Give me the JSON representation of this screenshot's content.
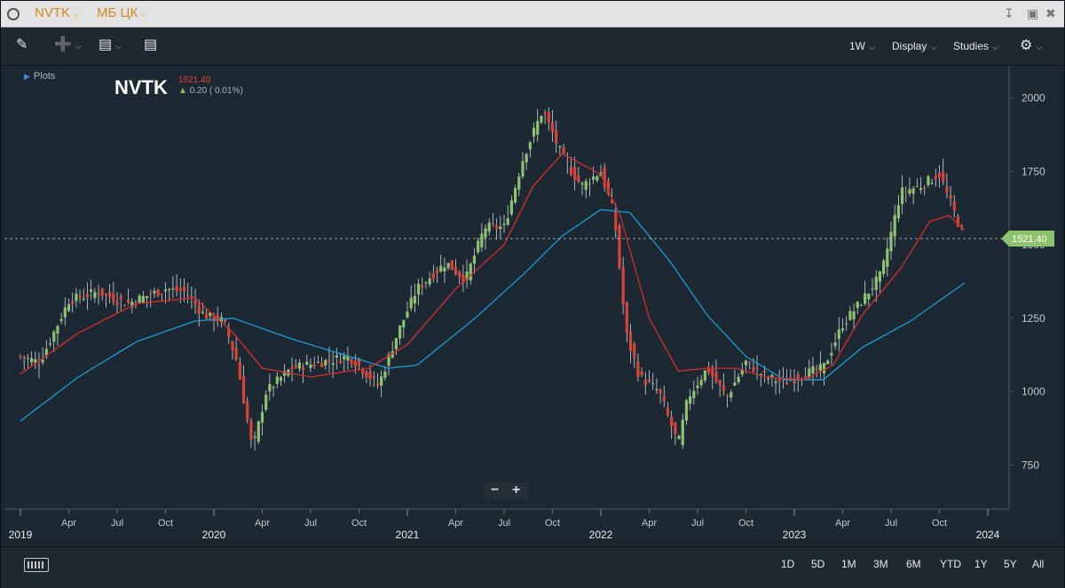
{
  "titlebar": {
    "symbol": "NVTK",
    "market": "МБ ЦК",
    "download_icon": "download-icon",
    "minimize_icon": "minimize-icon",
    "close_icon": "close-icon"
  },
  "toolbar": {
    "draw_icon": "pencil-icon",
    "crosshair_icon": "crosshair-icon",
    "comment_icon": "comment-icon",
    "table_icon": "table-icon",
    "interval": "1W",
    "display": "Display",
    "studies": "Studies",
    "settings_icon": "gear-icon"
  },
  "legend": {
    "plots_label": "Plots",
    "symbol": "NVTK",
    "last_price": "1521.40",
    "change": "0.20 ( 0.01%)"
  },
  "chart_data": {
    "type": "candlestick",
    "interval": "1W",
    "symbol": "NVTK",
    "y_ticks": [
      750,
      1000,
      1250,
      1500,
      1750,
      2000
    ],
    "ylim": [
      600,
      2050
    ],
    "last_price": 1521.4,
    "x_month_labels": [
      "Apr",
      "Jul",
      "Oct",
      "Apr",
      "Jul",
      "Oct",
      "Apr",
      "Jul",
      "Oct",
      "Apr",
      "Jul",
      "Oct",
      "Apr",
      "Jul",
      "Oct"
    ],
    "x_year_labels": [
      "2019",
      "2020",
      "2021",
      "2022",
      "2023",
      "2024"
    ],
    "close_series_approx": [
      [
        2019.0,
        1120
      ],
      [
        2019.1,
        1100
      ],
      [
        2019.25,
        1310
      ],
      [
        2019.4,
        1340
      ],
      [
        2019.55,
        1300
      ],
      [
        2019.75,
        1350
      ],
      [
        2019.85,
        1340
      ],
      [
        2019.95,
        1260
      ],
      [
        2020.05,
        1240
      ],
      [
        2020.12,
        1100
      ],
      [
        2020.2,
        800
      ],
      [
        2020.27,
        1000
      ],
      [
        2020.4,
        1080
      ],
      [
        2020.55,
        1100
      ],
      [
        2020.7,
        1120
      ],
      [
        2020.85,
        1020
      ],
      [
        2020.95,
        1200
      ],
      [
        2021.05,
        1350
      ],
      [
        2021.2,
        1440
      ],
      [
        2021.3,
        1380
      ],
      [
        2021.4,
        1560
      ],
      [
        2021.5,
        1560
      ],
      [
        2021.6,
        1800
      ],
      [
        2021.7,
        1960
      ],
      [
        2021.8,
        1800
      ],
      [
        2021.9,
        1700
      ],
      [
        2022.0,
        1750
      ],
      [
        2022.07,
        1600
      ],
      [
        2022.13,
        1200
      ],
      [
        2022.2,
        1050
      ],
      [
        2022.3,
        1000
      ],
      [
        2022.4,
        820
      ],
      [
        2022.45,
        980
      ],
      [
        2022.55,
        1080
      ],
      [
        2022.65,
        980
      ],
      [
        2022.75,
        1100
      ],
      [
        2022.85,
        1050
      ],
      [
        2022.95,
        1030
      ],
      [
        2023.05,
        1060
      ],
      [
        2023.15,
        1080
      ],
      [
        2023.25,
        1230
      ],
      [
        2023.35,
        1310
      ],
      [
        2023.45,
        1400
      ],
      [
        2023.55,
        1680
      ],
      [
        2023.65,
        1700
      ],
      [
        2023.75,
        1740
      ],
      [
        2023.82,
        1620
      ],
      [
        2023.88,
        1521.4
      ]
    ],
    "ma_short_approx": [
      [
        2019.0,
        1060
      ],
      [
        2019.3,
        1200
      ],
      [
        2019.6,
        1300
      ],
      [
        2019.9,
        1320
      ],
      [
        2020.1,
        1200
      ],
      [
        2020.25,
        1080
      ],
      [
        2020.5,
        1050
      ],
      [
        2020.8,
        1080
      ],
      [
        2021.0,
        1160
      ],
      [
        2021.25,
        1350
      ],
      [
        2021.5,
        1500
      ],
      [
        2021.65,
        1700
      ],
      [
        2021.8,
        1810
      ],
      [
        2022.0,
        1740
      ],
      [
        2022.1,
        1600
      ],
      [
        2022.25,
        1250
      ],
      [
        2022.4,
        1070
      ],
      [
        2022.55,
        1080
      ],
      [
        2022.7,
        1080
      ],
      [
        2022.85,
        1050
      ],
      [
        2023.05,
        1040
      ],
      [
        2023.2,
        1090
      ],
      [
        2023.35,
        1260
      ],
      [
        2023.55,
        1420
      ],
      [
        2023.7,
        1580
      ],
      [
        2023.8,
        1600
      ],
      [
        2023.88,
        1550
      ]
    ],
    "ma_long_approx": [
      [
        2019.0,
        900
      ],
      [
        2019.3,
        1050
      ],
      [
        2019.6,
        1170
      ],
      [
        2019.9,
        1240
      ],
      [
        2020.1,
        1250
      ],
      [
        2020.4,
        1180
      ],
      [
        2020.65,
        1130
      ],
      [
        2020.9,
        1080
      ],
      [
        2021.05,
        1090
      ],
      [
        2021.35,
        1250
      ],
      [
        2021.6,
        1400
      ],
      [
        2021.8,
        1530
      ],
      [
        2022.0,
        1620
      ],
      [
        2022.15,
        1610
      ],
      [
        2022.35,
        1450
      ],
      [
        2022.55,
        1260
      ],
      [
        2022.75,
        1120
      ],
      [
        2022.95,
        1040
      ],
      [
        2023.15,
        1040
      ],
      [
        2023.35,
        1150
      ],
      [
        2023.6,
        1240
      ],
      [
        2023.88,
        1370
      ]
    ],
    "colors": {
      "up": "#8dc26f",
      "down": "#d8433a",
      "ma_short": "#d82c2c",
      "ma_long": "#1c9bd6",
      "price_tag": "#8dc26f"
    },
    "grid": false
  },
  "zoom": {
    "minus": "−",
    "plus": "+"
  },
  "ranges": [
    "1D",
    "5D",
    "1M",
    "3M",
    "6M",
    "YTD",
    "1Y",
    "5Y",
    "All"
  ],
  "keyboard_icon": "keyboard-icon"
}
